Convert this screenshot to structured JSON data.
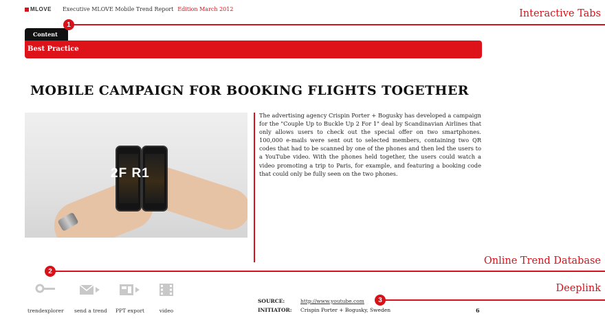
{
  "header": {
    "logo_text": "MLOVE",
    "title": "Executive MLOVE Mobile Trend Report",
    "edition": "Edition March 2012"
  },
  "tabs": {
    "active_label": "Content",
    "section_label": "Best Practice"
  },
  "article": {
    "headline": "MOBILE CAMPAIGN FOR BOOKING FLIGHTS TOGETHER",
    "image_text": "2F R1",
    "body": "The advertising agency Crispin Porter + Bogusky has developed a campaign for the \"Couple Up to Buckle Up 2 For 1\" deal by Scandinavian Airlines that only allows users to check out the special offer on two smartphones. 100,000 e-mails were sent out to selected members, containing two QR codes that had to be scanned by one of the phones and then led the users to a YouTube video. With the phones held together, the users could watch a video promoting a trip to Paris, for example, and featuring a booking code that could only be fully seen on the two phones."
  },
  "callouts": [
    {
      "number": "1",
      "label": "Interactive Tabs"
    },
    {
      "number": "2",
      "label": "Online Trend Database"
    },
    {
      "number": "3",
      "label": "Deeplink"
    }
  ],
  "toolbar": {
    "items": [
      {
        "label": "trendexplorer",
        "icon": "key-icon"
      },
      {
        "label": "send a trend",
        "icon": "mail-send-icon"
      },
      {
        "label": "PPT export",
        "icon": "presentation-export-icon"
      },
      {
        "label": "video",
        "icon": "film-icon"
      }
    ]
  },
  "source": {
    "source_label": "SOURCE:",
    "source_value": "http://www.youtube.com",
    "initiator_label": "INITIATOR:",
    "initiator_value": "Crispin Porter + Bogusky, Sweden"
  },
  "page_number": "6",
  "colors": {
    "accent": "#de1219",
    "tab_bg": "#111111",
    "icon_gray": "#c8c8c8"
  }
}
